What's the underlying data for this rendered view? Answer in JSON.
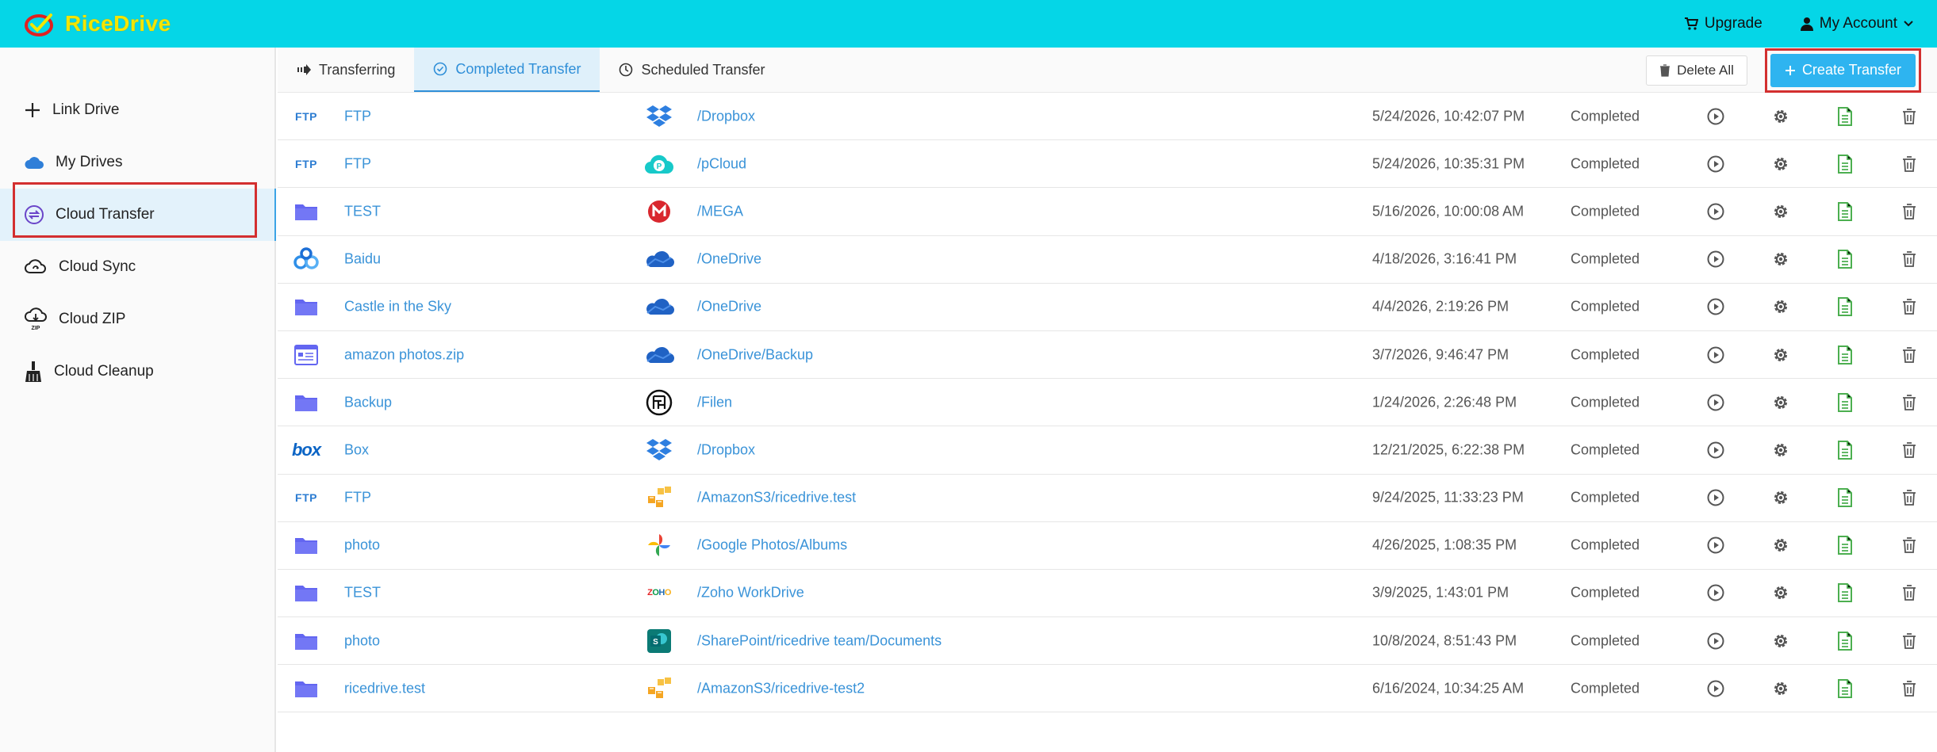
{
  "app": {
    "name": "RiceDrive"
  },
  "header": {
    "upgrade": "Upgrade",
    "account": "My Account"
  },
  "sidebar": {
    "items": [
      {
        "label": "Link Drive"
      },
      {
        "label": "My Drives"
      },
      {
        "label": "Cloud Transfer"
      },
      {
        "label": "Cloud Sync"
      },
      {
        "label": "Cloud ZIP"
      },
      {
        "label": "Cloud Cleanup"
      }
    ],
    "zip_badge": "ZIP"
  },
  "tabs": [
    {
      "label": "Transferring"
    },
    {
      "label": "Completed Transfer"
    },
    {
      "label": "Scheduled Transfer"
    }
  ],
  "actions": {
    "delete_all": "Delete All",
    "create_transfer": "Create Transfer"
  },
  "transfers": [
    {
      "source_icon": "ftp-icon",
      "source": "FTP",
      "dest_icon": "dropbox-icon",
      "dest": "/Dropbox",
      "time": "5/24/2026, 10:42:07 PM",
      "status": "Completed"
    },
    {
      "source_icon": "ftp-icon",
      "source": "FTP",
      "dest_icon": "pcloud-icon",
      "dest": "/pCloud",
      "time": "5/24/2026, 10:35:31 PM",
      "status": "Completed"
    },
    {
      "source_icon": "folder-icon",
      "source": "TEST",
      "dest_icon": "mega-icon",
      "dest": "/MEGA",
      "time": "5/16/2026, 10:00:08 AM",
      "status": "Completed"
    },
    {
      "source_icon": "baidu-icon",
      "source": "Baidu",
      "dest_icon": "onedrive-icon",
      "dest": "/OneDrive",
      "time": "4/18/2026, 3:16:41 PM",
      "status": "Completed"
    },
    {
      "source_icon": "folder-icon",
      "source": "Castle in the Sky",
      "dest_icon": "onedrive-icon",
      "dest": "/OneDrive",
      "time": "4/4/2026, 2:19:26 PM",
      "status": "Completed"
    },
    {
      "source_icon": "zip-file-icon",
      "source": "amazon photos.zip",
      "dest_icon": "onedrive-icon",
      "dest": "/OneDrive/Backup",
      "time": "3/7/2026, 9:46:47 PM",
      "status": "Completed"
    },
    {
      "source_icon": "folder-icon",
      "source": "Backup",
      "dest_icon": "filen-icon",
      "dest": "/Filen",
      "time": "1/24/2026, 2:26:48 PM",
      "status": "Completed"
    },
    {
      "source_icon": "box-icon",
      "source": "Box",
      "dest_icon": "dropbox-icon",
      "dest": "/Dropbox",
      "time": "12/21/2025, 6:22:38 PM",
      "status": "Completed"
    },
    {
      "source_icon": "ftp-icon",
      "source": "FTP",
      "dest_icon": "amazon-s3-icon",
      "dest": "/AmazonS3/ricedrive.test",
      "time": "9/24/2025, 11:33:23 PM",
      "status": "Completed"
    },
    {
      "source_icon": "folder-icon",
      "source": "photo",
      "dest_icon": "google-photos-icon",
      "dest": "/Google Photos/Albums",
      "time": "4/26/2025, 1:08:35 PM",
      "status": "Completed"
    },
    {
      "source_icon": "folder-icon",
      "source": "TEST",
      "dest_icon": "zoho-workdrive-icon",
      "dest": "/Zoho WorkDrive",
      "time": "3/9/2025, 1:43:01 PM",
      "status": "Completed"
    },
    {
      "source_icon": "folder-icon",
      "source": "photo",
      "dest_icon": "sharepoint-icon",
      "dest": "/SharePoint/ricedrive team/Documents",
      "time": "10/8/2024, 8:51:43 PM",
      "status": "Completed"
    },
    {
      "source_icon": "folder-icon",
      "source": "ricedrive.test",
      "dest_icon": "amazon-s3-icon",
      "dest": "/AmazonS3/ricedrive-test2",
      "time": "6/16/2024, 10:34:25 AM",
      "status": "Completed"
    }
  ],
  "brand_text": {
    "ftp": "FTP",
    "box": "box",
    "zoho": "ZOHO"
  },
  "colors": {
    "topbar": "#05d6e7",
    "accent": "#2eb4f0",
    "link": "#3a93d8",
    "highlight": "#d32f2f",
    "folder": "#6366f1",
    "log": "#4caf50"
  }
}
